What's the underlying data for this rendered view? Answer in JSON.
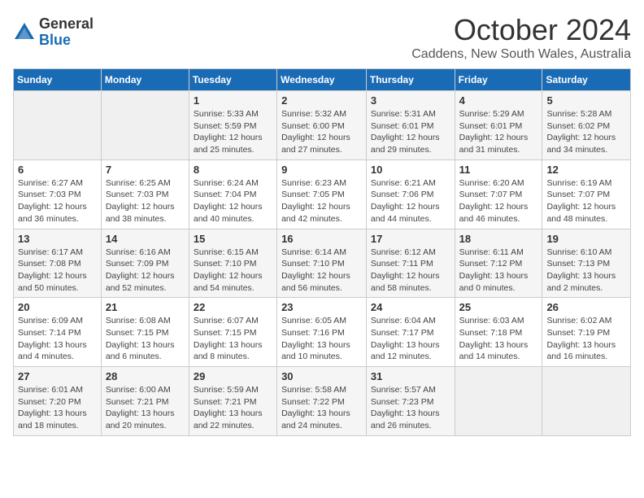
{
  "logo": {
    "general": "General",
    "blue": "Blue"
  },
  "title": "October 2024",
  "location": "Caddens, New South Wales, Australia",
  "days_of_week": [
    "Sunday",
    "Monday",
    "Tuesday",
    "Wednesday",
    "Thursday",
    "Friday",
    "Saturday"
  ],
  "weeks": [
    [
      {
        "day": "",
        "info": ""
      },
      {
        "day": "",
        "info": ""
      },
      {
        "day": "1",
        "info": "Sunrise: 5:33 AM\nSunset: 5:59 PM\nDaylight: 12 hours\nand 25 minutes."
      },
      {
        "day": "2",
        "info": "Sunrise: 5:32 AM\nSunset: 6:00 PM\nDaylight: 12 hours\nand 27 minutes."
      },
      {
        "day": "3",
        "info": "Sunrise: 5:31 AM\nSunset: 6:01 PM\nDaylight: 12 hours\nand 29 minutes."
      },
      {
        "day": "4",
        "info": "Sunrise: 5:29 AM\nSunset: 6:01 PM\nDaylight: 12 hours\nand 31 minutes."
      },
      {
        "day": "5",
        "info": "Sunrise: 5:28 AM\nSunset: 6:02 PM\nDaylight: 12 hours\nand 34 minutes."
      }
    ],
    [
      {
        "day": "6",
        "info": "Sunrise: 6:27 AM\nSunset: 7:03 PM\nDaylight: 12 hours\nand 36 minutes."
      },
      {
        "day": "7",
        "info": "Sunrise: 6:25 AM\nSunset: 7:03 PM\nDaylight: 12 hours\nand 38 minutes."
      },
      {
        "day": "8",
        "info": "Sunrise: 6:24 AM\nSunset: 7:04 PM\nDaylight: 12 hours\nand 40 minutes."
      },
      {
        "day": "9",
        "info": "Sunrise: 6:23 AM\nSunset: 7:05 PM\nDaylight: 12 hours\nand 42 minutes."
      },
      {
        "day": "10",
        "info": "Sunrise: 6:21 AM\nSunset: 7:06 PM\nDaylight: 12 hours\nand 44 minutes."
      },
      {
        "day": "11",
        "info": "Sunrise: 6:20 AM\nSunset: 7:07 PM\nDaylight: 12 hours\nand 46 minutes."
      },
      {
        "day": "12",
        "info": "Sunrise: 6:19 AM\nSunset: 7:07 PM\nDaylight: 12 hours\nand 48 minutes."
      }
    ],
    [
      {
        "day": "13",
        "info": "Sunrise: 6:17 AM\nSunset: 7:08 PM\nDaylight: 12 hours\nand 50 minutes."
      },
      {
        "day": "14",
        "info": "Sunrise: 6:16 AM\nSunset: 7:09 PM\nDaylight: 12 hours\nand 52 minutes."
      },
      {
        "day": "15",
        "info": "Sunrise: 6:15 AM\nSunset: 7:10 PM\nDaylight: 12 hours\nand 54 minutes."
      },
      {
        "day": "16",
        "info": "Sunrise: 6:14 AM\nSunset: 7:10 PM\nDaylight: 12 hours\nand 56 minutes."
      },
      {
        "day": "17",
        "info": "Sunrise: 6:12 AM\nSunset: 7:11 PM\nDaylight: 12 hours\nand 58 minutes."
      },
      {
        "day": "18",
        "info": "Sunrise: 6:11 AM\nSunset: 7:12 PM\nDaylight: 13 hours\nand 0 minutes."
      },
      {
        "day": "19",
        "info": "Sunrise: 6:10 AM\nSunset: 7:13 PM\nDaylight: 13 hours\nand 2 minutes."
      }
    ],
    [
      {
        "day": "20",
        "info": "Sunrise: 6:09 AM\nSunset: 7:14 PM\nDaylight: 13 hours\nand 4 minutes."
      },
      {
        "day": "21",
        "info": "Sunrise: 6:08 AM\nSunset: 7:15 PM\nDaylight: 13 hours\nand 6 minutes."
      },
      {
        "day": "22",
        "info": "Sunrise: 6:07 AM\nSunset: 7:15 PM\nDaylight: 13 hours\nand 8 minutes."
      },
      {
        "day": "23",
        "info": "Sunrise: 6:05 AM\nSunset: 7:16 PM\nDaylight: 13 hours\nand 10 minutes."
      },
      {
        "day": "24",
        "info": "Sunrise: 6:04 AM\nSunset: 7:17 PM\nDaylight: 13 hours\nand 12 minutes."
      },
      {
        "day": "25",
        "info": "Sunrise: 6:03 AM\nSunset: 7:18 PM\nDaylight: 13 hours\nand 14 minutes."
      },
      {
        "day": "26",
        "info": "Sunrise: 6:02 AM\nSunset: 7:19 PM\nDaylight: 13 hours\nand 16 minutes."
      }
    ],
    [
      {
        "day": "27",
        "info": "Sunrise: 6:01 AM\nSunset: 7:20 PM\nDaylight: 13 hours\nand 18 minutes."
      },
      {
        "day": "28",
        "info": "Sunrise: 6:00 AM\nSunset: 7:21 PM\nDaylight: 13 hours\nand 20 minutes."
      },
      {
        "day": "29",
        "info": "Sunrise: 5:59 AM\nSunset: 7:21 PM\nDaylight: 13 hours\nand 22 minutes."
      },
      {
        "day": "30",
        "info": "Sunrise: 5:58 AM\nSunset: 7:22 PM\nDaylight: 13 hours\nand 24 minutes."
      },
      {
        "day": "31",
        "info": "Sunrise: 5:57 AM\nSunset: 7:23 PM\nDaylight: 13 hours\nand 26 minutes."
      },
      {
        "day": "",
        "info": ""
      },
      {
        "day": "",
        "info": ""
      }
    ]
  ]
}
